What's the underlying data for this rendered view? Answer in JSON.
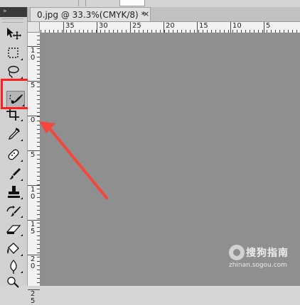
{
  "document": {
    "tab_title": "0.jpg @ 33.3%(CMYK/8) *",
    "close_glyph": "×"
  },
  "toolbar": {
    "collapse_glyph": "»",
    "tools": [
      {
        "name": "move-tool-icon"
      },
      {
        "name": "marquee-tool-icon"
      },
      {
        "name": "lasso-tool-icon"
      },
      {
        "name": "quick-selection-tool-icon",
        "active": true
      },
      {
        "name": "crop-tool-icon"
      },
      {
        "name": "eyedropper-tool-icon"
      },
      {
        "name": "healing-brush-tool-icon"
      },
      {
        "name": "brush-tool-icon"
      },
      {
        "name": "clone-stamp-tool-icon"
      },
      {
        "name": "history-brush-tool-icon"
      },
      {
        "name": "eraser-tool-icon"
      },
      {
        "name": "paint-bucket-tool-icon"
      },
      {
        "name": "blur-tool-icon"
      },
      {
        "name": "dodge-tool-icon"
      }
    ]
  },
  "ruler": {
    "top_labels": [
      "35",
      "30",
      "25",
      "20",
      "15",
      "10",
      "5"
    ],
    "left_labels": [
      "1\n0",
      "5",
      "0",
      "5",
      "1\n0",
      "1\n5",
      "2\n0",
      "2\n5"
    ]
  },
  "annotation": {
    "highlight_color": "#ff1e1e",
    "arrow_color": "#f5463c"
  },
  "watermark": {
    "brand": "搜狗指南",
    "url": "zhinan.sogou.com"
  }
}
